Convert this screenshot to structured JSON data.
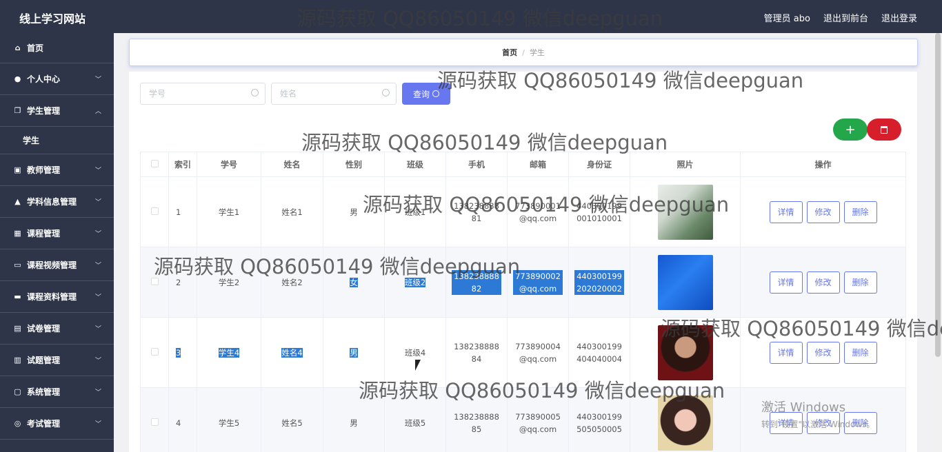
{
  "header": {
    "brand": "线上学习网站",
    "links": [
      "管理员 abo",
      "退出到前台",
      "退出登录"
    ]
  },
  "sidebar": {
    "items": [
      {
        "label": "首页",
        "icon": "home-icon",
        "chevron": ""
      },
      {
        "label": "个人中心",
        "icon": "user-icon",
        "chevron": "﹀"
      },
      {
        "label": "学生管理",
        "icon": "copy-icon",
        "chevron": "︿"
      },
      {
        "label": "教师管理",
        "icon": "badge-icon",
        "chevron": "﹀"
      },
      {
        "label": "学科信息管理",
        "icon": "cap-icon",
        "chevron": "﹀"
      },
      {
        "label": "课程管理",
        "icon": "grid-icon",
        "chevron": "﹀"
      },
      {
        "label": "课程视频管理",
        "icon": "chat-icon",
        "chevron": "﹀"
      },
      {
        "label": "课程资料管理",
        "icon": "monitor-icon",
        "chevron": "﹀"
      },
      {
        "label": "试卷管理",
        "icon": "paper-icon",
        "chevron": "﹀"
      },
      {
        "label": "试题管理",
        "icon": "clipboard-icon",
        "chevron": "﹀"
      },
      {
        "label": "系统管理",
        "icon": "system-icon",
        "chevron": "﹀"
      },
      {
        "label": "考试管理",
        "icon": "exam-icon",
        "chevron": "﹀"
      }
    ],
    "sub_item": "学生"
  },
  "breadcrumb": {
    "home": "首页",
    "sep": "/",
    "current": "学生"
  },
  "search": {
    "student_no_placeholder": "学号",
    "name_placeholder": "姓名",
    "button": "查询"
  },
  "actions": {
    "add": "+"
  },
  "table": {
    "headers": [
      "索引",
      "学号",
      "姓名",
      "性别",
      "班级",
      "手机",
      "邮箱",
      "身份证",
      "照片",
      "操作"
    ],
    "rows": [
      {
        "index": "1",
        "student_no": "学生1",
        "name": "姓名1",
        "gender": "男",
        "class": "班级1",
        "phone": "13823888881",
        "email": "773890001@qq.com",
        "id_card": "440300199001010001"
      },
      {
        "index": "2",
        "student_no": "学生2",
        "name": "姓名2",
        "gender": "女",
        "class": "班级2",
        "phone": "13823888882",
        "email": "773890002@qq.com",
        "id_card": "440300199202020002"
      },
      {
        "index": "3",
        "student_no": "学生4",
        "name": "姓名4",
        "gender": "男",
        "class": "班级4",
        "phone": "13823888884",
        "email": "773890004@qq.com",
        "id_card": "440300199404040004"
      },
      {
        "index": "4",
        "student_no": "学生5",
        "name": "姓名5",
        "gender": "男",
        "class": "班级5",
        "phone": "13823888885",
        "email": "773890005@qq.com",
        "id_card": "440300199505050005"
      }
    ],
    "op_labels": {
      "detail": "详情",
      "edit": "修改",
      "delete": "删除"
    }
  },
  "watermark": "源码获取 QQ86050149 微信deepguan",
  "activation": {
    "line1": "激活 Windows",
    "line2": "转到\"设置\"以激活 Windows。"
  }
}
